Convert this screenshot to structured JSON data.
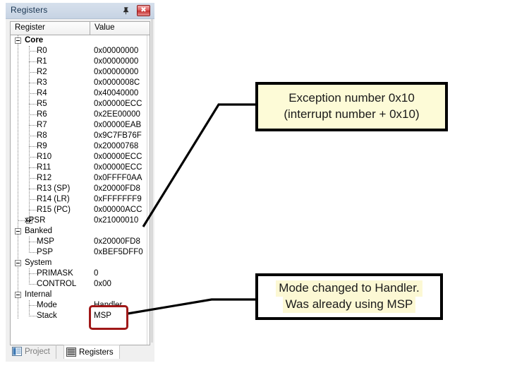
{
  "panel": {
    "title": "Registers",
    "pin_icon": "pin-icon",
    "close_icon": "close-icon",
    "columns": [
      {
        "label": "Register"
      },
      {
        "label": "Value"
      }
    ],
    "rows": [
      {
        "name": "Core",
        "value": "",
        "level": 0,
        "type": "group",
        "toggle": "minus"
      },
      {
        "name": "R0",
        "value": "0x00000000",
        "level": 2,
        "type": "leaf"
      },
      {
        "name": "R1",
        "value": "0x00000000",
        "level": 2,
        "type": "leaf"
      },
      {
        "name": "R2",
        "value": "0x00000000",
        "level": 2,
        "type": "leaf"
      },
      {
        "name": "R3",
        "value": "0x0000008C",
        "level": 2,
        "type": "leaf"
      },
      {
        "name": "R4",
        "value": "0x40040000",
        "level": 2,
        "type": "leaf"
      },
      {
        "name": "R5",
        "value": "0x00000ECC",
        "level": 2,
        "type": "leaf"
      },
      {
        "name": "R6",
        "value": "0x2EE00000",
        "level": 2,
        "type": "leaf"
      },
      {
        "name": "R7",
        "value": "0x00000EAB",
        "level": 2,
        "type": "leaf"
      },
      {
        "name": "R8",
        "value": "0x9C7FB76F",
        "level": 2,
        "type": "leaf"
      },
      {
        "name": "R9",
        "value": "0x20000768",
        "level": 2,
        "type": "leaf"
      },
      {
        "name": "R10",
        "value": "0x00000ECC",
        "level": 2,
        "type": "leaf"
      },
      {
        "name": "R11",
        "value": "0x00000ECC",
        "level": 2,
        "type": "leaf"
      },
      {
        "name": "R12",
        "value": "0x0FFFF0AA",
        "level": 2,
        "type": "leaf"
      },
      {
        "name": "R13 (SP)",
        "value": "0x20000FD8",
        "level": 2,
        "type": "leaf"
      },
      {
        "name": "R14 (LR)",
        "value": "0xFFFFFFF9",
        "level": 2,
        "type": "leaf"
      },
      {
        "name": "R15 (PC)",
        "value": "0x00000ACC",
        "level": 2,
        "type": "leaf"
      },
      {
        "name": "xPSR",
        "value": "0x21000010",
        "level": 1,
        "type": "expandable",
        "toggle": "plus"
      },
      {
        "name": "Banked",
        "value": "",
        "level": 0,
        "type": "grouplite",
        "toggle": "minus"
      },
      {
        "name": "MSP",
        "value": "0x20000FD8",
        "level": 2,
        "type": "leaf"
      },
      {
        "name": "PSP",
        "value": "0xBEF5DFF0",
        "level": 2,
        "type": "leaf"
      },
      {
        "name": "System",
        "value": "",
        "level": 0,
        "type": "grouplite",
        "toggle": "minus"
      },
      {
        "name": "PRIMASK",
        "value": "0",
        "level": 2,
        "type": "leaf"
      },
      {
        "name": "CONTROL",
        "value": "0x00",
        "level": 2,
        "type": "leaf"
      },
      {
        "name": "Internal",
        "value": "",
        "level": 0,
        "type": "grouplite",
        "toggle": "minus"
      },
      {
        "name": "Mode",
        "value": "Handler",
        "level": 2,
        "type": "leaf"
      },
      {
        "name": "Stack",
        "value": "MSP",
        "level": 2,
        "type": "leaf"
      }
    ],
    "tabs": [
      {
        "label": "Project",
        "icon": "project-icon",
        "active": false
      },
      {
        "label": "Registers",
        "icon": "registers-icon",
        "active": true
      }
    ]
  },
  "annotations": {
    "exception": {
      "line1": "Exception number 0x10",
      "line2": "(interrupt number + 0x10)"
    },
    "mode": {
      "line1": "Mode changed to Handler.",
      "line2": "Was already using MSP"
    }
  },
  "colors": {
    "callout_yellow": "#fdfbd7",
    "highlight_red": "#a01818",
    "titlebar_blue": "#cfdae8",
    "close_red": "#c33030"
  }
}
